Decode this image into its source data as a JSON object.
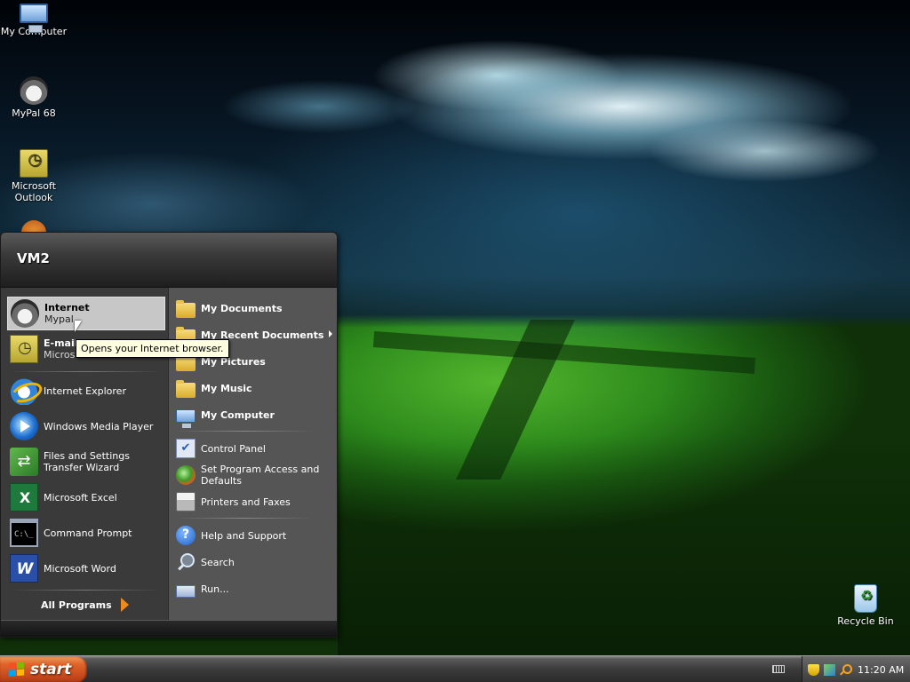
{
  "desktop": {
    "icons": [
      {
        "label": "My Computer"
      },
      {
        "label": "MyPal 68"
      },
      {
        "label": "Microsoft Outlook"
      },
      {
        "label": "Recycle Bin"
      }
    ]
  },
  "start_menu": {
    "user": "VM2",
    "pinned": [
      {
        "title": "Internet",
        "subtitle": "Mypal",
        "icon": "mypal-icon"
      },
      {
        "title": "E-mail",
        "subtitle": "Microsoft Outlook",
        "icon": "outlook-icon"
      }
    ],
    "recent": [
      {
        "label": "Internet Explorer",
        "icon": "internet-explorer-icon"
      },
      {
        "label": "Windows Media Player",
        "icon": "media-player-icon"
      },
      {
        "label": "Files and Settings Transfer Wizard",
        "icon": "transfer-wizard-icon"
      },
      {
        "label": "Microsoft Excel",
        "icon": "excel-icon"
      },
      {
        "label": "Command Prompt",
        "icon": "command-prompt-icon"
      },
      {
        "label": "Microsoft Word",
        "icon": "word-icon"
      }
    ],
    "all_programs": "All Programs",
    "places": [
      {
        "label": "My Documents",
        "icon": "folder-icon"
      },
      {
        "label": "My Recent Documents",
        "icon": "folder-icon"
      },
      {
        "label": "My Pictures",
        "icon": "folder-icon"
      },
      {
        "label": "My Music",
        "icon": "folder-icon"
      },
      {
        "label": "My Computer",
        "icon": "computer-icon"
      }
    ],
    "settings": [
      {
        "label": "Control Panel",
        "icon": "control-panel-icon"
      },
      {
        "label": "Set Program Access and Defaults",
        "icon": "program-access-icon"
      },
      {
        "label": "Printers and Faxes",
        "icon": "printer-icon"
      }
    ],
    "tools": [
      {
        "label": "Help and Support",
        "icon": "help-icon"
      },
      {
        "label": "Search",
        "icon": "search-icon"
      },
      {
        "label": "Run...",
        "icon": "run-icon"
      }
    ]
  },
  "tooltip": "Opens your Internet browser.",
  "taskbar": {
    "start_label": "start",
    "clock": "11:20 AM"
  },
  "colors": {
    "start_button": "#e0642a",
    "menu_left": "#3a3a3a",
    "menu_right": "#555556",
    "tooltip_bg": "#ffffe1"
  }
}
